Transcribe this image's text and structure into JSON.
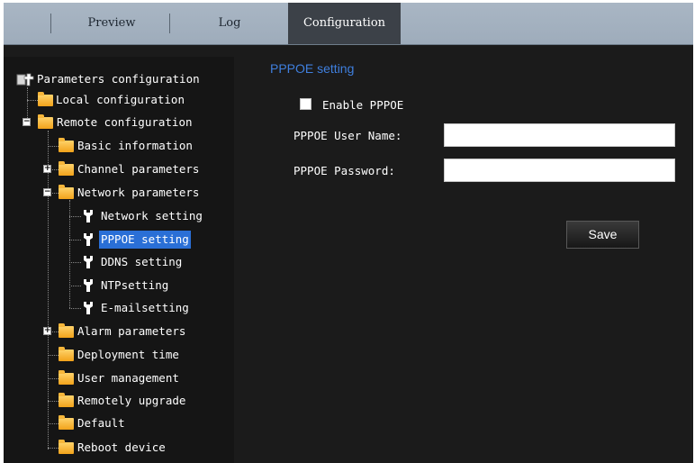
{
  "tabs": [
    {
      "label": "Preview",
      "active": false
    },
    {
      "label": "Log",
      "active": false
    },
    {
      "label": "Configuration",
      "active": true
    }
  ],
  "tree": {
    "root": "Parameters configuration",
    "local": "Local configuration",
    "remote": "Remote configuration",
    "basic_info": "Basic information",
    "channel_params": "Channel parameters",
    "network_params": "Network parameters",
    "network_setting": "Network setting",
    "pppoe_setting": "PPPOE setting",
    "ddns_setting": "DDNS setting",
    "ntp_setting": "NTPsetting",
    "email_setting": "E-mailsetting",
    "alarm_params": "Alarm parameters",
    "deployment_time": "Deployment time",
    "user_management": "User management",
    "remote_upgrade": "Remotely upgrade",
    "default": "Default",
    "reboot": "Reboot device"
  },
  "form": {
    "title": "PPPOE setting",
    "enable_label": "Enable PPPOE",
    "enable_checked": false,
    "username_label": "PPPOE User Name:",
    "username_value": "",
    "password_label": "PPPOE Password:",
    "password_value": "",
    "save_label": "Save"
  },
  "colors": {
    "accent": "#3f7fde",
    "selection": "#2a6fd6",
    "folder": "#f2a21a",
    "topbar": "#9eacbb",
    "background": "#1b1b1b"
  },
  "icons": {
    "folder": "folder-icon",
    "wrench": "wrench-icon",
    "settings_root": "tools-icon",
    "expand": "plus-box-icon",
    "collapse": "minus-box-icon"
  }
}
